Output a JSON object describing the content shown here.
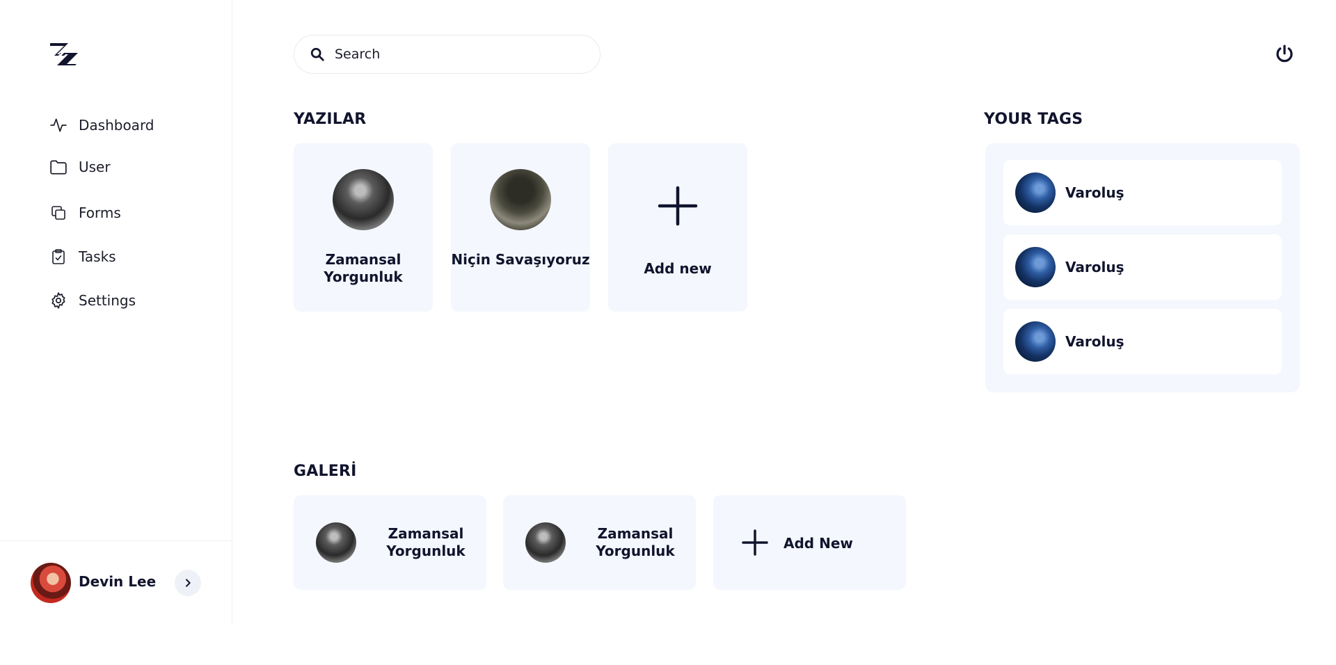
{
  "sidebar": {
    "logo_icon": "z-logo-icon",
    "items": [
      {
        "label": "Dashboard",
        "icon": "activity-icon"
      },
      {
        "label": "User",
        "icon": "folder-icon"
      },
      {
        "label": "Forms",
        "icon": "copy-icon"
      },
      {
        "label": "Tasks",
        "icon": "clipboard-check-icon"
      },
      {
        "label": "Settings",
        "icon": "gear-icon"
      }
    ],
    "user": {
      "name": "Devin Lee",
      "toggle_icon": "chevron-right-icon"
    }
  },
  "header": {
    "search": {
      "placeholder": "Search",
      "icon": "search-icon"
    },
    "power_icon": "power-icon"
  },
  "yazilar": {
    "title": "YAZILAR",
    "cards": [
      {
        "title": "Zamansal Yorgunluk"
      },
      {
        "title": "Niçin Savaşıyoruz"
      }
    ],
    "add_label": "Add new"
  },
  "tags": {
    "title": "YOUR TAGS",
    "items": [
      {
        "label": "Varoluş"
      },
      {
        "label": "Varoluş"
      },
      {
        "label": "Varoluş"
      }
    ]
  },
  "galeri": {
    "title": "GALERİ",
    "cards": [
      {
        "title": "Zamansal Yorgunluk"
      },
      {
        "title": "Zamansal Yorgunluk"
      }
    ],
    "add_label": "Add New"
  },
  "colors": {
    "card_bg": "#f4f7fd",
    "text": "#11142d",
    "border": "#eef0f4"
  }
}
